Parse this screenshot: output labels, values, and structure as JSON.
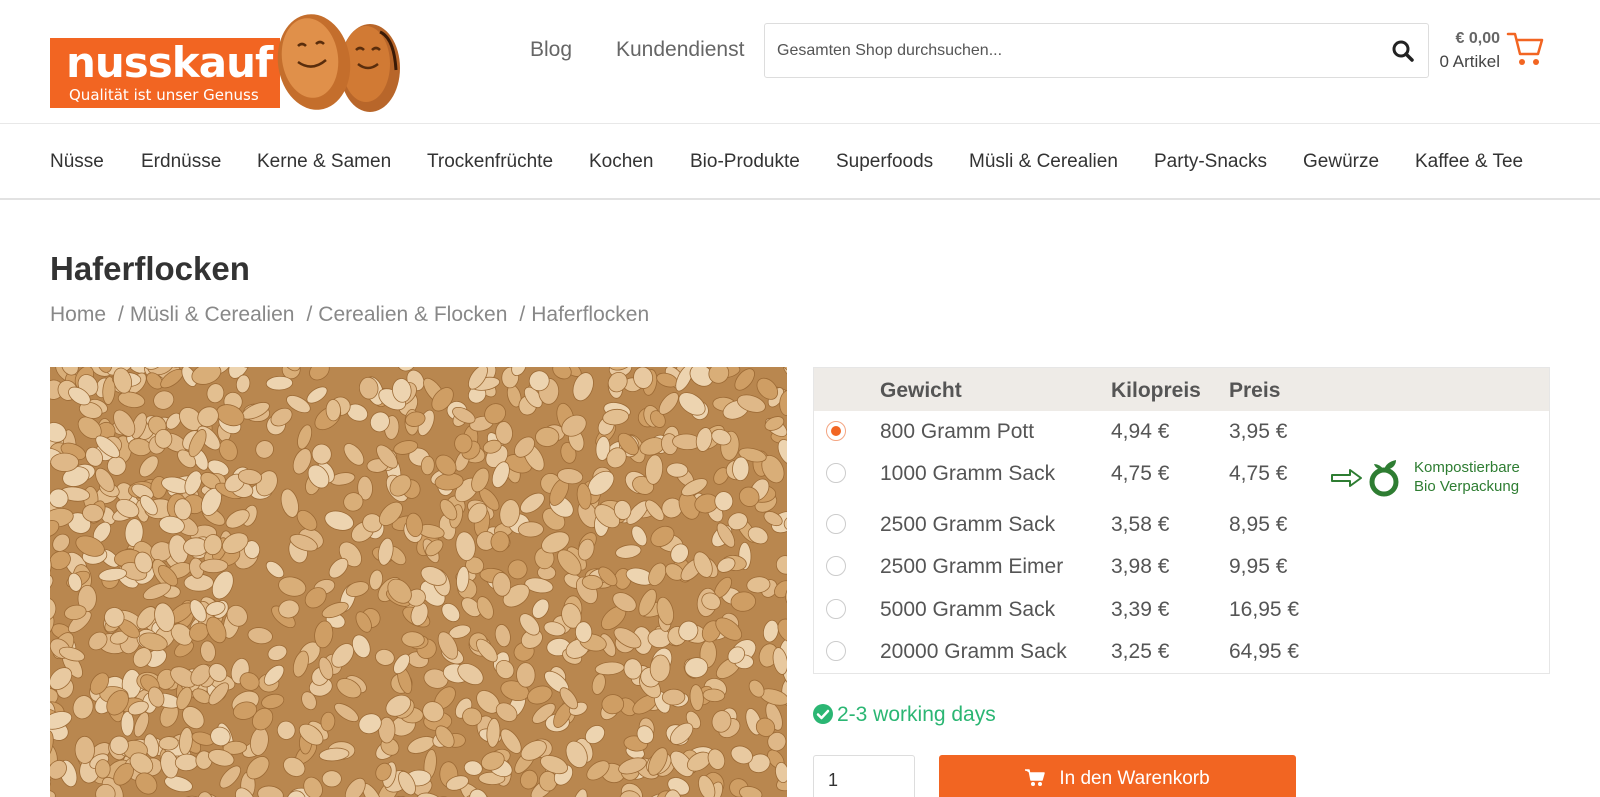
{
  "logo": {
    "name": "nusskauf",
    "tagline": "Qualität ist unser Genuss"
  },
  "header": {
    "links": [
      "Blog",
      "Kundendienst"
    ],
    "search_placeholder": "Gesamten Shop durchsuchen...",
    "search_icon": "search-icon",
    "cart_total": "€ 0,00",
    "cart_items": "0 Artikel",
    "cart_icon": "cart-icon"
  },
  "nav": {
    "items": [
      "Nüsse",
      "Erdnüsse",
      "Kerne & Samen",
      "Trockenfrüchte",
      "Kochen",
      "Bio-Produkte",
      "Superfoods",
      "Müsli & Cerealien",
      "Party-Snacks",
      "Gewürze",
      "Kaffee & Tee"
    ]
  },
  "page": {
    "title": "Haferflocken",
    "breadcrumb": [
      "Home",
      "Müsli & Cerealien",
      "Cerealien & Flocken",
      "Haferflocken"
    ]
  },
  "variants": {
    "headers": [
      "Gewicht",
      "Kilopreis",
      "Preis"
    ],
    "rows": [
      {
        "weight": "800 Gramm Pott",
        "kilo_price": "4,94 €",
        "price": "3,95 €",
        "selected": true
      },
      {
        "weight": "1000 Gramm Sack",
        "kilo_price": "4,75 €",
        "price": "4,75 €",
        "selected": false
      },
      {
        "weight": "2500 Gramm Sack",
        "kilo_price": "3,58 €",
        "price": "8,95 €",
        "selected": false
      },
      {
        "weight": "2500 Gramm Eimer",
        "kilo_price": "3,98 €",
        "price": "9,95 €",
        "selected": false
      },
      {
        "weight": "5000 Gramm Sack",
        "kilo_price": "3,39 €",
        "price": "16,95 €",
        "selected": false
      },
      {
        "weight": "20000 Gramm Sack",
        "kilo_price": "3,25 €",
        "price": "64,95 €",
        "selected": false
      }
    ],
    "badge_line1": "Kompostierbare",
    "badge_line2": "Bio Verpackung"
  },
  "delivery": "2-3 working days",
  "purchase": {
    "quantity": "1",
    "add_to_cart": "In den Warenkorb"
  },
  "colors": {
    "brand": "#f26522",
    "delivery_green": "#2bb673",
    "badge_green": "#2e7d32"
  }
}
